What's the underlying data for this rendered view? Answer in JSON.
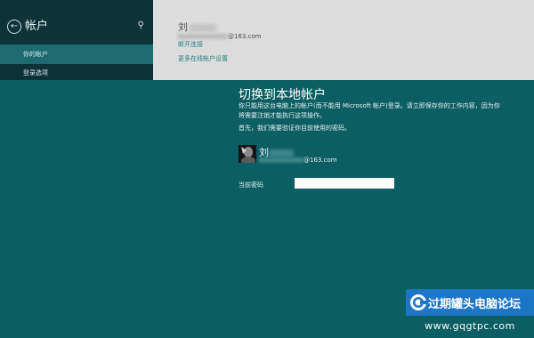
{
  "sidebar": {
    "title": "帐户",
    "items": [
      {
        "label": "你的帐户"
      },
      {
        "label": "登录选项"
      }
    ]
  },
  "account": {
    "name": "刘",
    "email_suffix": "@163.com",
    "disconnect_label": "断开连接",
    "more_settings_label": "更多在线帐户设置"
  },
  "dialog": {
    "title": "切换到本地帐户",
    "description": "你只能用这台电脑上的帐户(而不能用 Microsoft 帐户)登录。请立即保存你的工作内容，因为你将需要注销才能执行这项操作。",
    "first_step": "首先，我们需要验证你目前使用的密码。",
    "user_name": "刘",
    "user_email_suffix": "@163.com",
    "password_label": "当前密码",
    "password_value": ""
  },
  "watermark": {
    "name": "过期罐头电脑论坛",
    "url": "www.gqgtpc.com"
  },
  "colors": {
    "dialog_bg": "#0b5e63",
    "sidebar_bg": "#0d3337",
    "active_item_bg": "#1d6b70",
    "content_bg": "#dcdcdc",
    "link": "#2a7f84",
    "watermark_bg": "#1d75c6"
  },
  "icons": [
    "back-arrow-icon",
    "search-icon",
    "user-avatar",
    "watermark-logo-icon"
  ]
}
